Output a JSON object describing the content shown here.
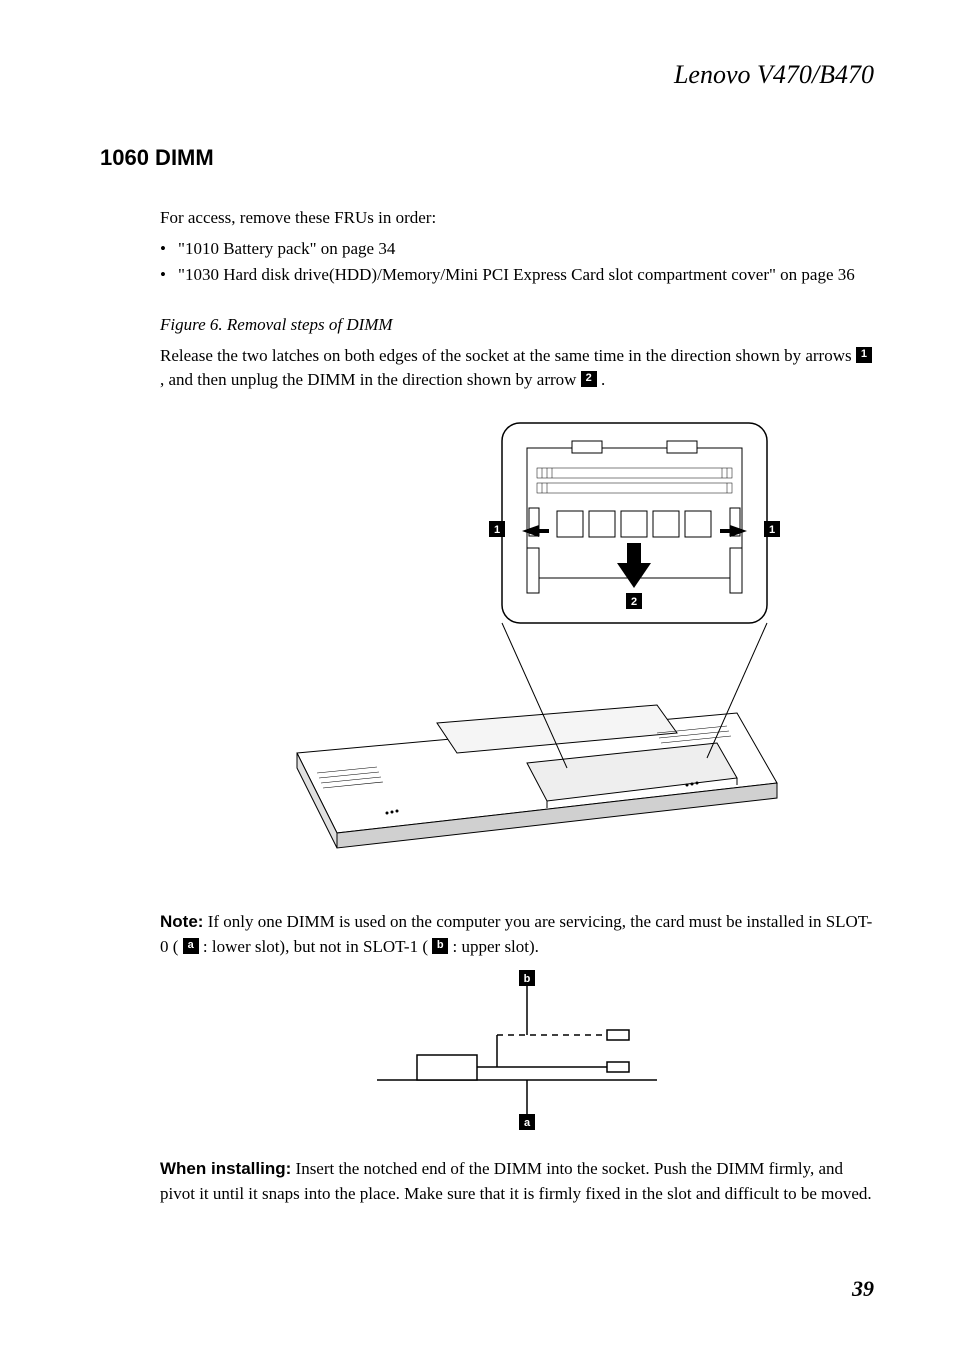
{
  "header": {
    "title": "Lenovo V470/B470"
  },
  "section": {
    "heading": "1060 DIMM"
  },
  "intro": "For access, remove these FRUs in order:",
  "bullets": [
    "\"1010 Battery pack\" on page 34",
    "\"1030 Hard disk drive(HDD)/Memory/Mini PCI Express Card slot compartment cover\" on page 36"
  ],
  "figure": {
    "caption": "Figure 6. Removal steps of DIMM",
    "desc_pre": "Release the two latches on both edges of the socket at the same time in the direction shown by arrows ",
    "marker1": "1",
    "desc_mid": " , and then unplug the DIMM in the direction shown by arrow ",
    "marker2": "2",
    "desc_post": " ."
  },
  "callouts_fig1": {
    "left": "1",
    "right": "1",
    "center": "2"
  },
  "note": {
    "label": "Note:",
    "text_pre": " If only one DIMM is used on the computer you are servicing, the card must be installed in SLOT-0 ( ",
    "marker_a": "a",
    "text_mid": "  : lower slot), but not in SLOT-1 ( ",
    "marker_b": "b",
    "text_post": "  : upper slot)."
  },
  "callouts_fig2": {
    "top": "b",
    "bottom": "a"
  },
  "install": {
    "label": "When installing:",
    "text": " Insert the notched end of the DIMM into the socket. Push the DIMM firmly, and pivot it until it snaps into the place. Make sure that it is firmly fixed in the slot and difficult to be moved."
  },
  "page_number": "39"
}
